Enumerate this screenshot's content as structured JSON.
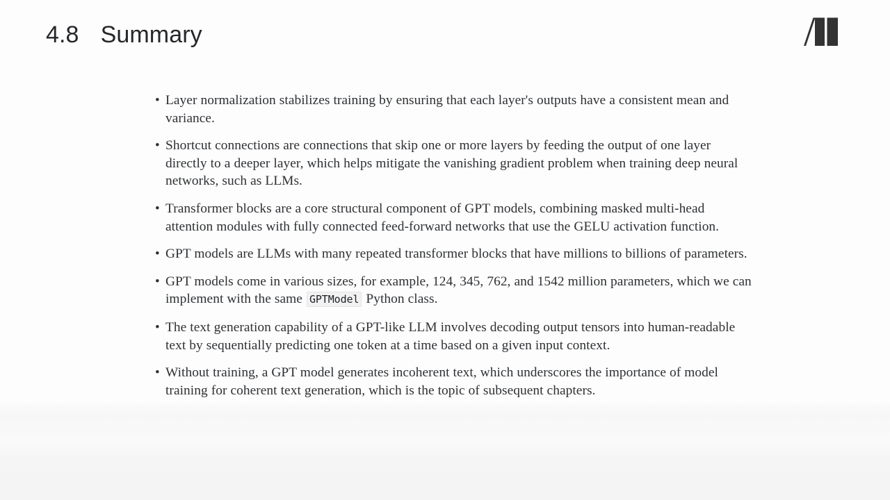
{
  "header": {
    "section_number": "4.8",
    "title": "Summary",
    "logo_name": "manning-publications-logo"
  },
  "main": {
    "bullet_marker": "•",
    "bullets": [
      {
        "id": "layer-normalization",
        "text": "Layer normalization stabilizes training by ensuring that each layer's outputs have a consistent mean and variance."
      },
      {
        "id": "shortcut-connections",
        "text": "Shortcut connections are connections that skip one or more layers by feeding the output of one layer directly to a deeper layer, which helps mitigate the vanishing gradient problem when training deep neural networks, such as LLMs."
      },
      {
        "id": "transformer-blocks",
        "text": "Transformer blocks are a core structural component of GPT models, combining masked multi-head attention modules with fully connected feed-forward networks that use the GELU activation function."
      },
      {
        "id": "gpt-models-repeated-blocks",
        "text": "GPT models are LLMs with many repeated transformer blocks that have millions to billions of parameters."
      },
      {
        "id": "gpt-model-sizes",
        "text_before_code": "GPT models come in various sizes, for example, 124, 345, 762, and 1542 million parameters, which we can implement with the same ",
        "code": "GPTModel",
        "text_after_code": " Python class."
      },
      {
        "id": "text-generation-capability",
        "text": "The text generation capability of a GPT-like LLM involves decoding output tensors into human-readable text by sequentially predicting one token at a time based on a given input context."
      },
      {
        "id": "without-training-incoherent",
        "text": "Without training, a GPT model generates incoherent text, which underscores the importance of model training for coherent text generation, which is the topic of subsequent chapters."
      }
    ]
  },
  "colors": {
    "page_background": "#fdfdfd",
    "heading_text": "#25272a",
    "body_text": "#2e3033",
    "logo_dark": "#333333",
    "code_background": "#f2f2f2"
  }
}
